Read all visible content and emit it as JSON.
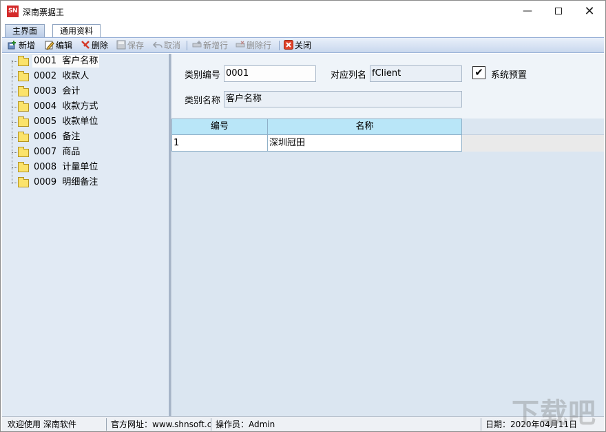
{
  "window": {
    "app_icon_text": "SN",
    "title": "深南票据王"
  },
  "tabs": [
    {
      "label": "主界面",
      "active": false
    },
    {
      "label": "通用资料",
      "active": true
    }
  ],
  "toolbar": {
    "new": "新增",
    "edit": "编辑",
    "delete": "删除",
    "save": "保存",
    "cancel": "取消",
    "add_row": "新增行",
    "delete_row": "删除行",
    "close": "关闭"
  },
  "tree": {
    "items": [
      {
        "code": "0001",
        "name": "客户名称",
        "selected": true
      },
      {
        "code": "0002",
        "name": "收款人"
      },
      {
        "code": "0003",
        "name": "会计"
      },
      {
        "code": "0004",
        "name": "收款方式"
      },
      {
        "code": "0005",
        "name": "收款单位"
      },
      {
        "code": "0006",
        "name": "备注"
      },
      {
        "code": "0007",
        "name": "商品"
      },
      {
        "code": "0008",
        "name": "计量单位"
      },
      {
        "code": "0009",
        "name": "明细备注"
      }
    ]
  },
  "form": {
    "category_code_label": "类别编号",
    "category_code_value": "0001",
    "column_name_label": "对应列名",
    "column_name_value": "fClient",
    "system_preset_label": "系统预置",
    "system_preset_checked": "✔",
    "category_name_label": "类别名称",
    "category_name_value": "客户名称"
  },
  "grid": {
    "columns": [
      "编号",
      "名称"
    ],
    "rows": [
      [
        "1",
        "深圳冠田"
      ]
    ]
  },
  "statusbar": {
    "welcome": "欢迎使用 深南软件",
    "website": "官方网址：www.shnsoft.cc",
    "operator": "操作员：Admin",
    "date": "日期：2020年04月11日"
  },
  "watermark": "下载吧"
}
